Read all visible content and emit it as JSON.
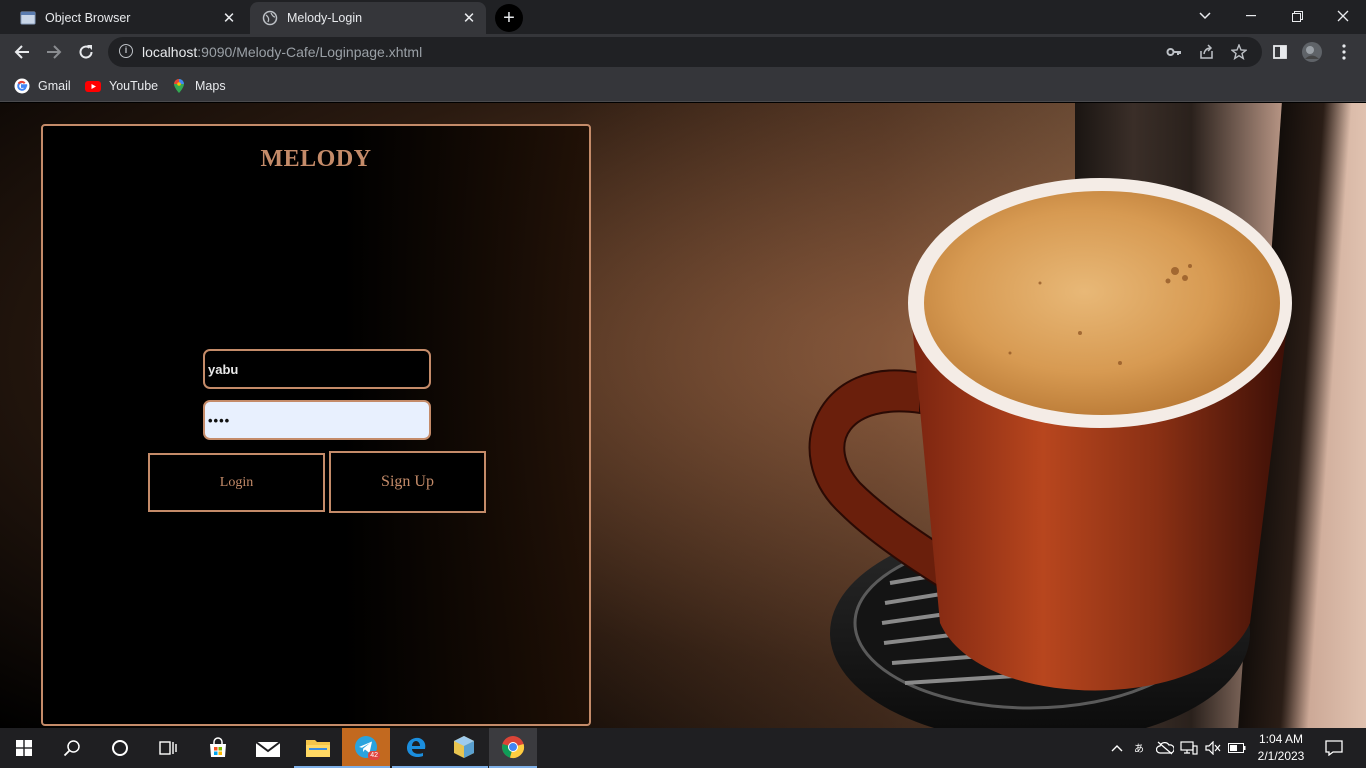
{
  "browser": {
    "tabs": [
      {
        "title": "Object Browser",
        "active": false
      },
      {
        "title": "Melody-Login",
        "active": true
      }
    ],
    "url_host": "localhost",
    "url_rest": ":9090/Melody-Cafe/Loginpage.xhtml",
    "bookmarks": [
      {
        "label": "Gmail",
        "icon": "google-icon"
      },
      {
        "label": "YouTube",
        "icon": "youtube-icon"
      },
      {
        "label": "Maps",
        "icon": "maps-icon"
      }
    ]
  },
  "page": {
    "brand": "MELODY",
    "username_value": "yabu",
    "password_mask": "••••",
    "login_label": "Login",
    "signup_label": "Sign Up",
    "accent_color": "#c48b69"
  },
  "taskbar": {
    "telegram_badge": "42",
    "time": "1:04 AM",
    "date": "2/1/2023"
  }
}
